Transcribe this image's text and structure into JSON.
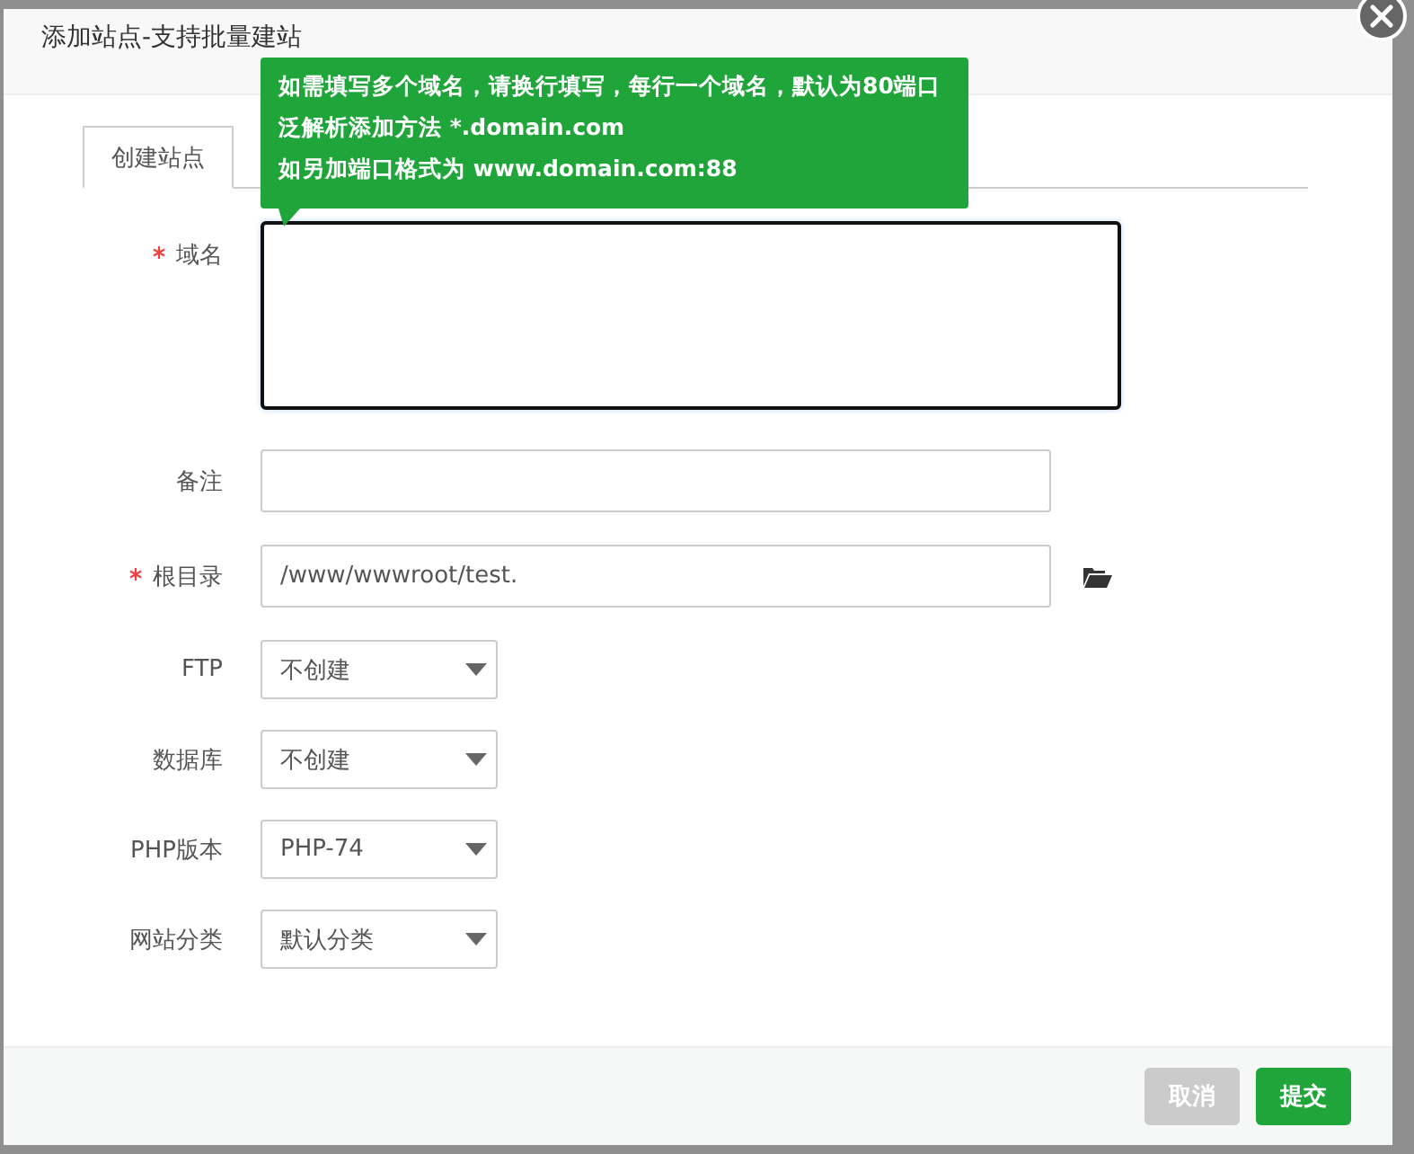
{
  "dialog": {
    "title": "添加站点-支持批量建站"
  },
  "tabs": [
    {
      "label": "创建站点",
      "selected": true
    }
  ],
  "tooltip": {
    "lines": [
      "如需填写多个域名，请换行填写，每行一个域名，默认为80端口",
      "泛解析添加方法 *.domain.com",
      "如另加端口格式为 www.domain.com:88"
    ]
  },
  "fields": [
    {
      "kind": "textarea",
      "label": "域名",
      "required": true,
      "focused": true
    },
    {
      "kind": "input",
      "label": "备注",
      "required": false,
      "focused": false
    },
    {
      "kind": "path",
      "label": "根目录",
      "required": true,
      "value": "/www/wwwroot/test.",
      "focused": false
    },
    {
      "kind": "select",
      "label": "FTP",
      "required": false,
      "value": "不创建",
      "focused": false
    },
    {
      "kind": "select",
      "label": "数据库",
      "required": false,
      "value": "不创建",
      "focused": false
    },
    {
      "kind": "select",
      "label": "PHP版本",
      "required": false,
      "value": "PHP-74",
      "focused": false
    },
    {
      "kind": "select",
      "label": "网站分类",
      "required": false,
      "value": "默认分类",
      "focused": false
    }
  ],
  "buttons": [
    {
      "kind": "cancel",
      "label": "取消"
    },
    {
      "kind": "submit",
      "label": "提交"
    }
  ]
}
